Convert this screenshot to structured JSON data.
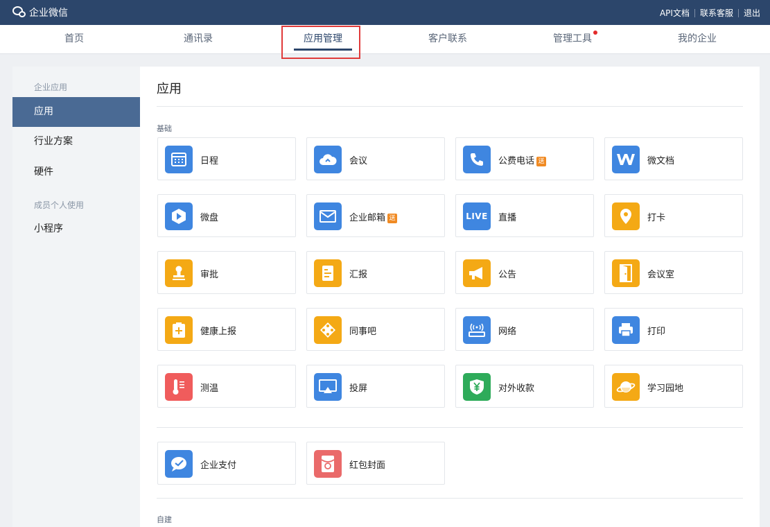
{
  "topbar": {
    "brand": "企业微信",
    "links": [
      "API文档",
      "联系客服",
      "退出"
    ]
  },
  "nav": {
    "tabs": [
      {
        "label": "首页"
      },
      {
        "label": "通讯录"
      },
      {
        "label": "应用管理",
        "active": true
      },
      {
        "label": "客户联系"
      },
      {
        "label": "管理工具",
        "dot": true
      },
      {
        "label": "我的企业"
      }
    ]
  },
  "sidebar": {
    "group1": "企业应用",
    "items1": [
      "应用",
      "行业方案",
      "硬件"
    ],
    "group2": "成员个人使用",
    "items2": [
      "小程序"
    ]
  },
  "content": {
    "title": "应用",
    "section_basic": "基础",
    "section_custom": "自建",
    "badge": "送",
    "apps": [
      {
        "name": "日程",
        "icon": "calendar-icon",
        "color": "#3f86e0"
      },
      {
        "name": "会议",
        "icon": "cloud-meeting-icon",
        "color": "#3f86e0"
      },
      {
        "name": "公费电话",
        "icon": "phone-icon",
        "color": "#3f86e0",
        "badge": true
      },
      {
        "name": "微文档",
        "icon": "doc-w-icon",
        "color": "#3f86e0"
      },
      {
        "name": "微盘",
        "icon": "drive-icon",
        "color": "#3f86e0"
      },
      {
        "name": "企业邮箱",
        "icon": "mail-icon",
        "color": "#3f86e0",
        "badge": true
      },
      {
        "name": "直播",
        "icon": "live-icon",
        "color": "#3f86e0",
        "label": "LIVE"
      },
      {
        "name": "打卡",
        "icon": "location-pin-icon",
        "color": "#f4a915"
      },
      {
        "name": "审批",
        "icon": "stamp-icon",
        "color": "#f4a915"
      },
      {
        "name": "汇报",
        "icon": "report-icon",
        "color": "#f4a915"
      },
      {
        "name": "公告",
        "icon": "megaphone-icon",
        "color": "#f4a915"
      },
      {
        "name": "会议室",
        "icon": "door-icon",
        "color": "#f4a915"
      },
      {
        "name": "健康上报",
        "icon": "medical-icon",
        "color": "#f4a915"
      },
      {
        "name": "同事吧",
        "icon": "diamond-icon",
        "color": "#f4a915"
      },
      {
        "name": "网络",
        "icon": "wifi-router-icon",
        "color": "#3f86e0"
      },
      {
        "name": "打印",
        "icon": "printer-icon",
        "color": "#3f86e0"
      },
      {
        "name": "测温",
        "icon": "thermometer-icon",
        "color": "#f05c5c"
      },
      {
        "name": "投屏",
        "icon": "screen-cast-icon",
        "color": "#3f86e0"
      },
      {
        "name": "对外收款",
        "icon": "yuan-shield-icon",
        "color": "#2eab5a"
      },
      {
        "name": "学习园地",
        "icon": "planet-icon",
        "color": "#f4a915"
      }
    ],
    "apps2": [
      {
        "name": "企业支付",
        "icon": "payment-chat-icon",
        "color": "#3f86e0"
      },
      {
        "name": "红包封面",
        "icon": "red-packet-icon",
        "color": "#ea6a6a"
      }
    ]
  }
}
